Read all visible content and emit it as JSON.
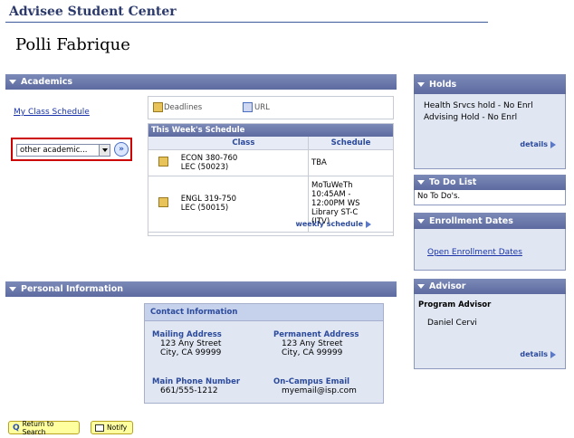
{
  "header": {
    "title": "Advisee Student Center",
    "student_name": "Polli Fabrique"
  },
  "academics": {
    "section_title": "Academics",
    "my_class_schedule_link": "My Class Schedule",
    "dropdown_value": "other academic...",
    "deadlines_label": "Deadlines",
    "url_label": "URL",
    "schedule_title": "This Week's Schedule",
    "columns": [
      "Class",
      "Schedule"
    ],
    "rows": [
      {
        "class_line1": "ECON 380-760",
        "class_line2": "LEC (50023)",
        "schedule": "TBA"
      },
      {
        "class_line1": "ENGL 319-750",
        "class_line2": "LEC (50015)",
        "schedule": "MoTuWeTh 10:45AM - 12:00PM WS Library ST-C (ITV)"
      }
    ],
    "weekly_schedule_link": "weekly schedule"
  },
  "personal": {
    "section_title": "Personal Information",
    "contact_header": "Contact Information",
    "mailing_label": "Mailing Address",
    "mailing_line1": "123 Any Street",
    "mailing_line2": "City, CA 99999",
    "permanent_label": "Permanent Address",
    "permanent_line1": "123 Any Street",
    "permanent_line2": "City, CA 99999",
    "phone_label": "Main Phone Number",
    "phone_value": "661/555-1212",
    "email_label": "On-Campus Email",
    "email_value": "myemail@isp.com"
  },
  "holds": {
    "title": "Holds",
    "items": [
      "Health Srvcs hold - No Enrl",
      "Advising Hold - No Enrl"
    ],
    "details": "details"
  },
  "todo": {
    "title": "To Do List",
    "text": "No To Do's."
  },
  "enrollment": {
    "title": "Enrollment Dates",
    "link": "Open Enrollment Dates"
  },
  "advisor": {
    "title": "Advisor",
    "subtitle": "Program Advisor",
    "name": "Daniel Cervi",
    "details": "details"
  },
  "footer": {
    "return_button": "Return to Search",
    "notify_button": "Notify"
  },
  "colors": {
    "section_bar": "#6674ab",
    "panel_bg": "#e0e7f3",
    "link": "#1a33a8",
    "dropdown_highlight": "#cc0000"
  }
}
